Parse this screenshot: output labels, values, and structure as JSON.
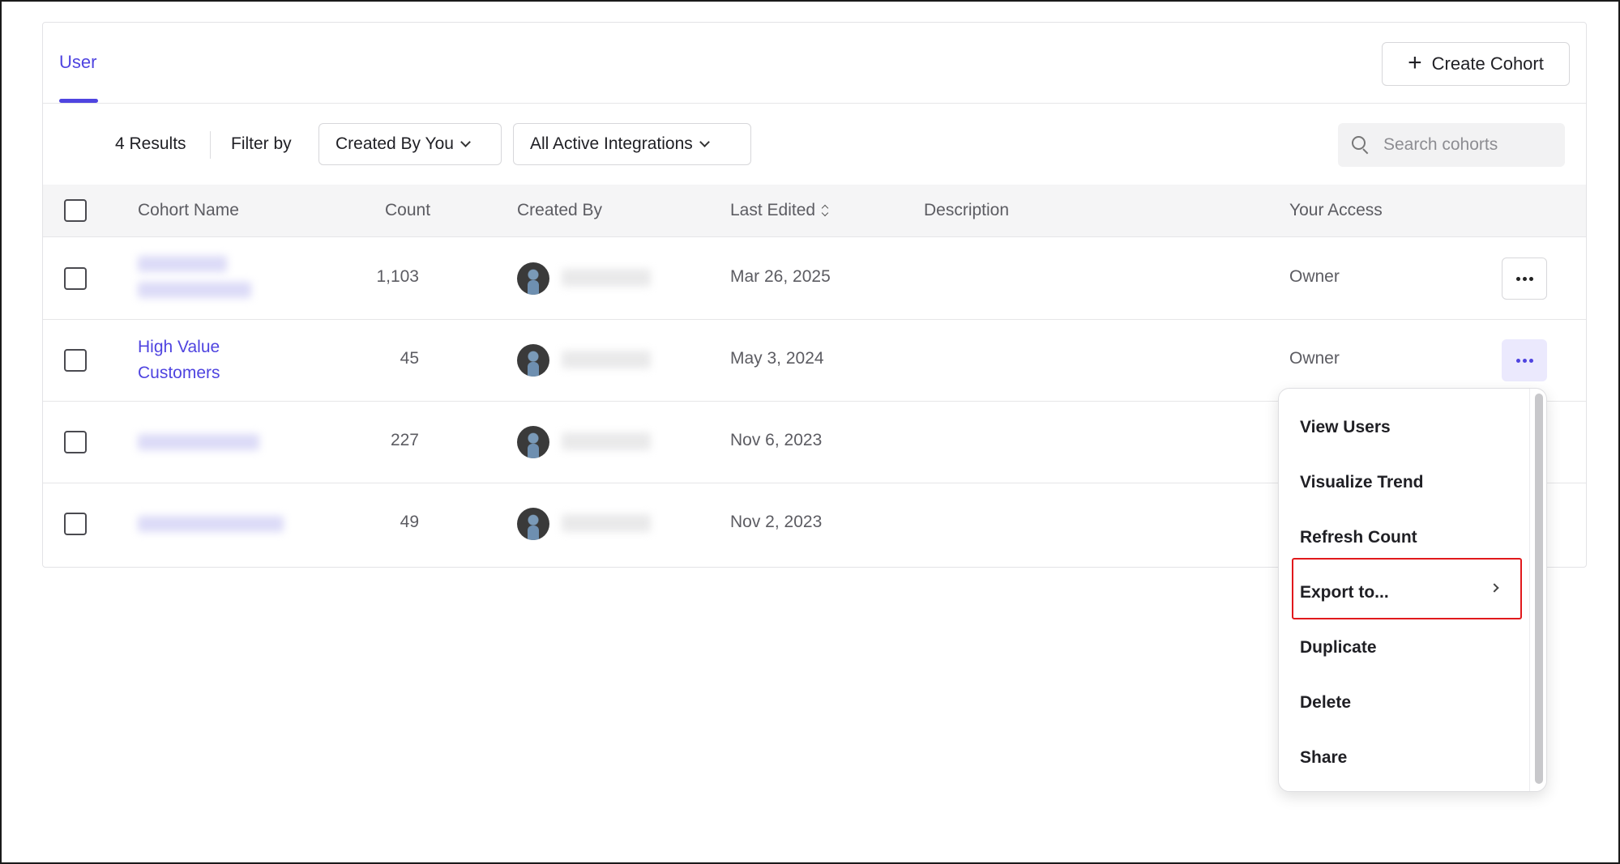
{
  "tabs": [
    {
      "label": "User",
      "active": true
    }
  ],
  "header": {
    "create_label": "Create Cohort"
  },
  "filters": {
    "results_label": "4 Results",
    "filter_by_label": "Filter by",
    "created_by_value": "Created By You",
    "integrations_value": "All Active Integrations",
    "search_placeholder": "Search cohorts"
  },
  "table": {
    "columns": [
      "Cohort Name",
      "Count",
      "Created By",
      "Last Edited",
      "Description",
      "Your Access"
    ],
    "rows": [
      {
        "name": "",
        "count": "1,103",
        "last_edited": "Mar 26, 2025",
        "description": "",
        "access": "Owner"
      },
      {
        "name_line1": "High Value",
        "name_line2": "Customers",
        "count": "45",
        "last_edited": "May 3, 2024",
        "description": "",
        "access": "Owner"
      },
      {
        "name": "",
        "count": "227",
        "last_edited": "Nov 6, 2023",
        "description": "",
        "access": ""
      },
      {
        "name": "",
        "count": "49",
        "last_edited": "Nov 2, 2023",
        "description": "",
        "access": ""
      }
    ]
  },
  "menu": {
    "items": [
      "View Users",
      "Visualize Trend",
      "Refresh Count",
      "Export to...",
      "Duplicate",
      "Delete",
      "Share"
    ],
    "highlighted": "Export to..."
  },
  "colors": {
    "accent": "#4f44e0",
    "highlight_border": "#e1191c"
  }
}
